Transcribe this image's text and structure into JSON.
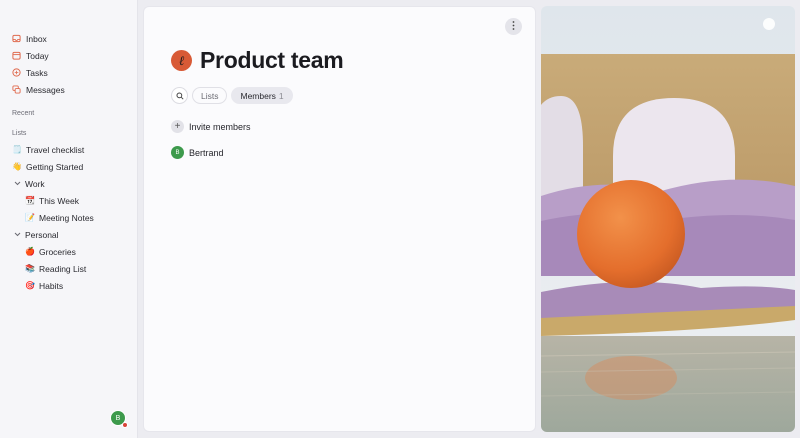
{
  "sidebar": {
    "nav": [
      {
        "label": "Inbox",
        "icon": "inbox-icon"
      },
      {
        "label": "Today",
        "icon": "calendar-icon"
      },
      {
        "label": "Tasks",
        "icon": "tasks-icon"
      },
      {
        "label": "Messages",
        "icon": "messages-icon"
      }
    ],
    "recent_label": "Recent",
    "lists_label": "Lists",
    "lists": {
      "travel": {
        "emoji": "🗒️",
        "label": "Travel checklist"
      },
      "getting_started": {
        "emoji": "👋",
        "label": "Getting Started"
      },
      "work": {
        "label": "Work"
      },
      "this_week": {
        "emoji": "📆",
        "label": "This Week"
      },
      "meeting_notes": {
        "emoji": "📝",
        "label": "Meeting Notes"
      },
      "personal": {
        "label": "Personal"
      },
      "groceries": {
        "emoji": "🍎",
        "label": "Groceries"
      },
      "reading_list": {
        "emoji": "📚",
        "label": "Reading List"
      },
      "habits": {
        "emoji": "🎯",
        "label": "Habits"
      }
    },
    "user_initial": "B"
  },
  "main": {
    "team_icon_glyph": "ℓ",
    "title": "Product team",
    "tabs": [
      {
        "label": "Lists"
      },
      {
        "label": "Members",
        "count": "1"
      }
    ],
    "invite_label": "Invite members",
    "members": [
      {
        "initial": "B",
        "name": "Bertrand"
      }
    ]
  },
  "colors": {
    "accent_orange": "#d85a36",
    "avatar_green": "#3d9a4c",
    "status_red": "#d8453a"
  }
}
